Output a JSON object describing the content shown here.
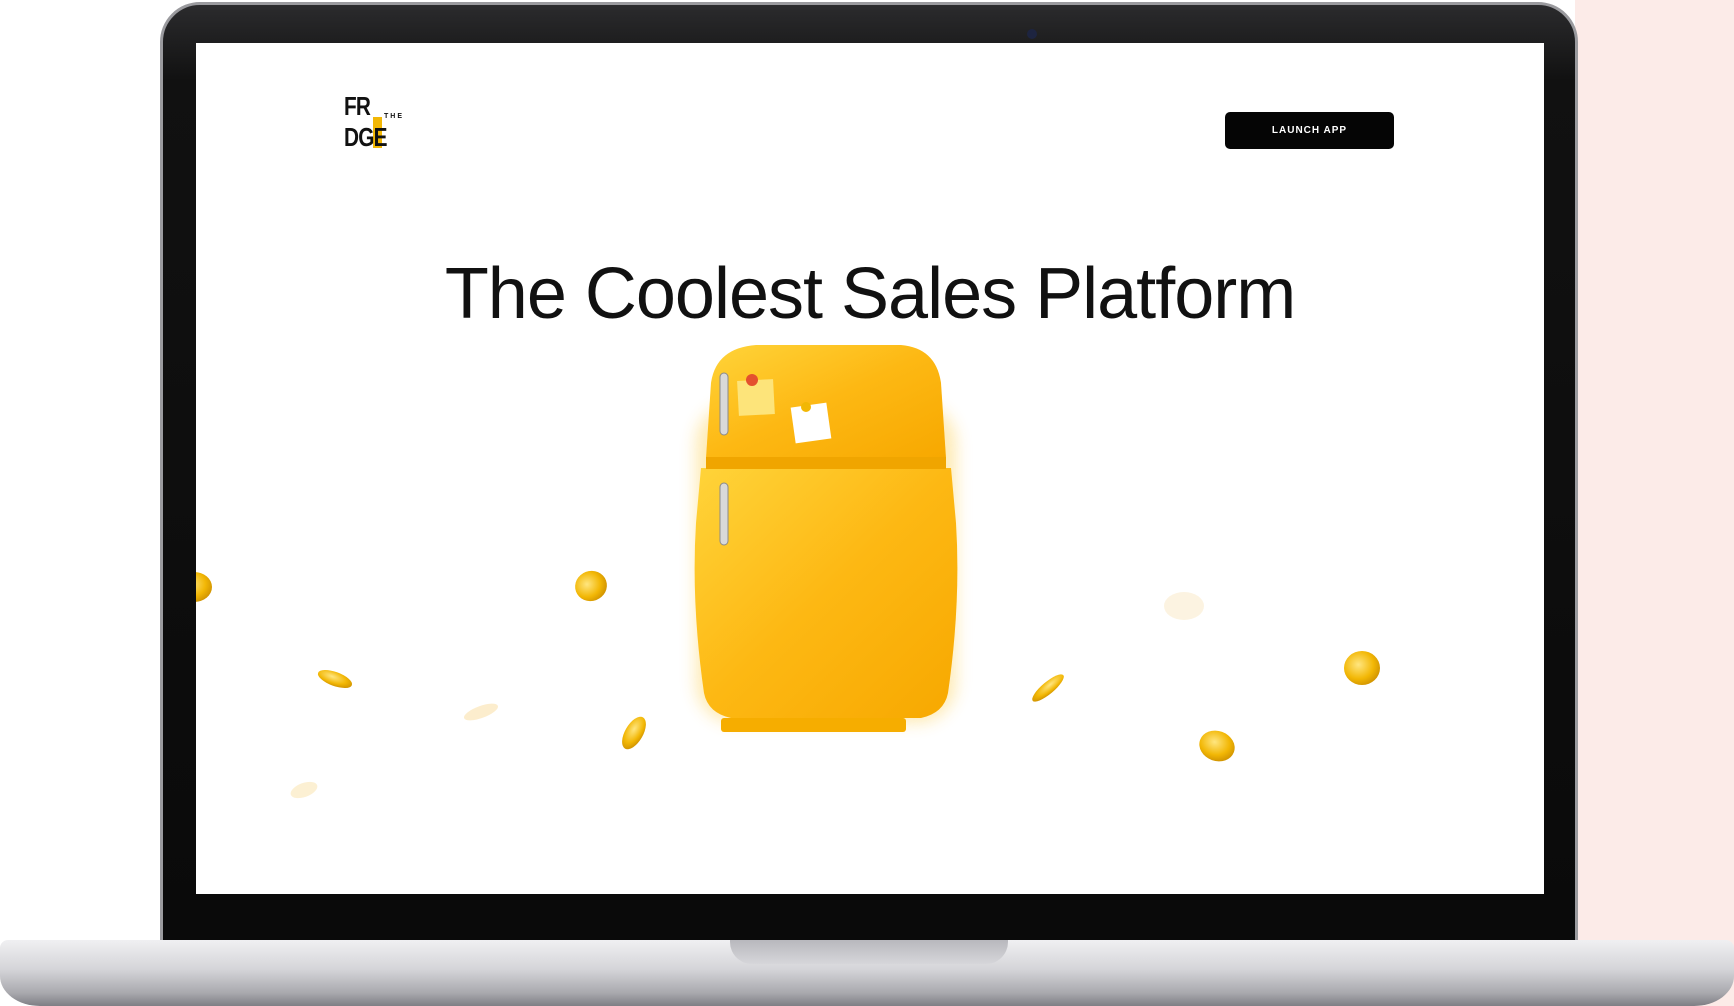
{
  "header": {
    "logo": {
      "text": "FR DGE",
      "small": "THE"
    },
    "launch_button": "LAUNCH APP"
  },
  "hero": {
    "headline": "The Coolest Sales Platform"
  },
  "colors": {
    "accent": "#f2b705",
    "fridge": "#fdb813",
    "button_bg": "#050505",
    "page_bg": "#ffffff",
    "side_bg": "#fcebe8"
  }
}
